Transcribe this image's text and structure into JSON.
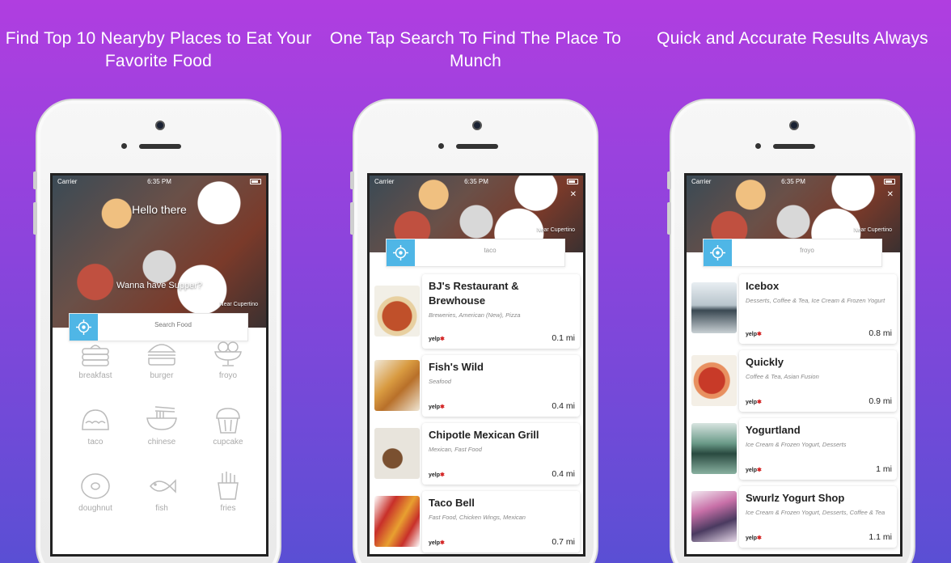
{
  "captions": [
    "Find Top 10 Nearyby Places to Eat Your Favorite Food",
    "One Tap Search To Find The Place To Munch",
    "Quick and Accurate Results Always"
  ],
  "status": {
    "carrier": "Carrier",
    "time": "6:35 PM"
  },
  "screen1": {
    "greeting": "Hello there",
    "prompt": "Wanna have Supper?",
    "location": "Near Cupertino",
    "search_placeholder": "Search Food",
    "categories": [
      "breakfast",
      "burger",
      "froyo",
      "taco",
      "chinese",
      "cupcake",
      "doughnut",
      "fish",
      "fries"
    ]
  },
  "screen2": {
    "location": "Near Cupertino",
    "search_value": "taco",
    "results": [
      {
        "name": "BJ's Restaurant & Brewhouse",
        "categories": "Breweries, American (New), Pizza",
        "distance": "0.1 mi",
        "source": "yelp"
      },
      {
        "name": "Fish's Wild",
        "categories": "Seafood",
        "distance": "0.4 mi",
        "source": "yelp"
      },
      {
        "name": "Chipotle Mexican Grill",
        "categories": "Mexican, Fast Food",
        "distance": "0.4 mi",
        "source": "yelp"
      },
      {
        "name": "Taco Bell",
        "categories": "Fast Food, Chicken Wings, Mexican",
        "distance": "0.7 mi",
        "source": "yelp"
      }
    ]
  },
  "screen3": {
    "location": "Near Cupertino",
    "search_value": "froyo",
    "results": [
      {
        "name": "Icebox",
        "categories": "Desserts, Coffee & Tea, Ice Cream & Frozen Yogurt",
        "distance": "0.8 mi",
        "source": "yelp"
      },
      {
        "name": "Quickly",
        "categories": "Coffee & Tea, Asian Fusion",
        "distance": "0.9 mi",
        "source": "yelp"
      },
      {
        "name": "Yogurtland",
        "categories": "Ice Cream & Frozen Yogurt, Desserts",
        "distance": "1 mi",
        "source": "yelp"
      },
      {
        "name": "Swurlz Yogurt Shop",
        "categories": "Ice Cream & Frozen Yogurt, Desserts, Coffee & Tea",
        "distance": "1.1 mi",
        "source": "yelp"
      }
    ]
  },
  "colors": {
    "accent": "#4fb6e6",
    "yelp": "#d32323",
    "bg_top": "#b03ee0",
    "bg_bottom": "#5a4fd4"
  },
  "icons": [
    "crosshair-icon",
    "wifi-icon",
    "battery-icon",
    "close-icon"
  ]
}
